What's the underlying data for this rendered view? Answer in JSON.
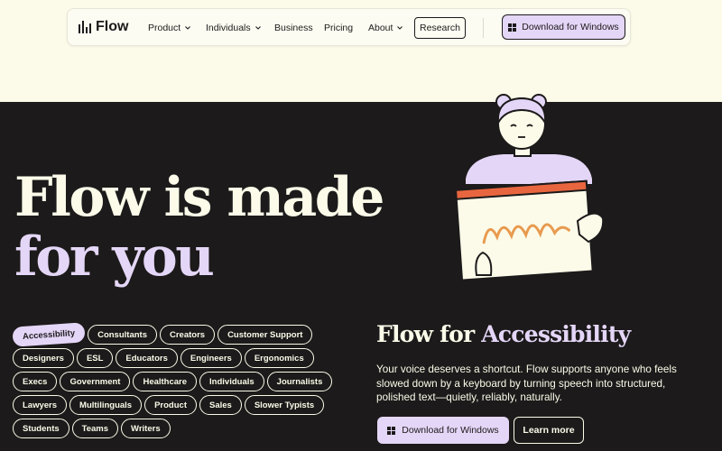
{
  "brand": {
    "name": "Flow"
  },
  "nav": {
    "product": "Product",
    "individuals": "Individuals",
    "business": "Business",
    "pricing": "Pricing",
    "about": "About",
    "research": "Research",
    "download": "Download for Windows"
  },
  "hero": {
    "line1": "Flow is made",
    "line2": "for you"
  },
  "tags": [
    [
      "Accessibility",
      "Consultants",
      "Creators",
      "Customer Support"
    ],
    [
      "Designers",
      "ESL",
      "Educators",
      "Engineers",
      "Ergonomics"
    ],
    [
      "Execs",
      "Government",
      "Healthcare",
      "Individuals",
      "Journalists"
    ],
    [
      "Lawyers",
      "Multilinguals",
      "Product",
      "Sales",
      "Slower Typists"
    ],
    [
      "Students",
      "Teams",
      "Writers"
    ]
  ],
  "active_tag": "Accessibility",
  "section": {
    "title_prefix": "Flow for",
    "title_highlight": "Accessibility",
    "description": "Your voice deserves a shortcut. Flow supports anyone who feels slowed down by a keyboard by turning speech into structured, polished text—quietly, reliably, naturally.",
    "download": "Download for Windows",
    "learn_more": "Learn more"
  },
  "colors": {
    "dark": "#1c1a1a",
    "cream": "#fcfbe9",
    "lavender": "#e4d6f7",
    "orange": "#e8663f"
  }
}
